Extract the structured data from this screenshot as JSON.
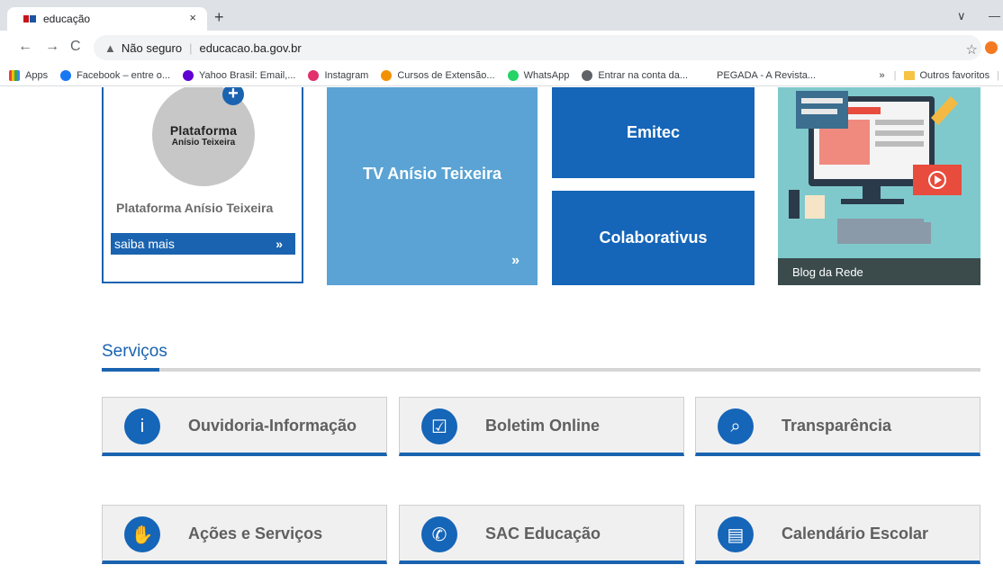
{
  "browser": {
    "tab_title": "educação",
    "tab_close": "×",
    "new_tab": "+",
    "minimize": "—",
    "chevron": "∨",
    "security": "Não seguro",
    "url": "educacao.ba.gov.br",
    "bookmarks": [
      {
        "label": "Apps",
        "color": "#4285f4"
      },
      {
        "label": "Facebook – entre o...",
        "color": "#1877f2"
      },
      {
        "label": "Yahoo Brasil: Email,...",
        "color": "#6001d2"
      },
      {
        "label": "Instagram",
        "color": "#e1306c"
      },
      {
        "label": "Cursos de Extensão...",
        "color": "#f29100"
      },
      {
        "label": "WhatsApp",
        "color": "#25d366"
      },
      {
        "label": "Entrar na conta da...",
        "color": "#5f6368"
      },
      {
        "label": "PEGADA - A Revista...",
        "color": "#ffffff"
      }
    ],
    "bookmarks_more": "»",
    "other_favorites": "Outros favoritos"
  },
  "tiles": {
    "plataforma": {
      "logo_line1": "Plataforma",
      "logo_line2": "Anísio Teixeira",
      "title": "Plataforma Anísio Teixeira",
      "button": "saiba mais",
      "arrow": "»"
    },
    "tv": {
      "title": "TV Anísio Teixeira",
      "arrow": "»"
    },
    "emitec": "Emitec",
    "colaborativus": "Colaborativus",
    "blog": "Blog da Rede"
  },
  "servicos": {
    "title": "Serviços",
    "items": [
      {
        "label": "Ouvidoria-Informação",
        "icon": "info-icon"
      },
      {
        "label": "Boletim Online",
        "icon": "checkbox-icon"
      },
      {
        "label": "Transparência",
        "icon": "magnifier-icon"
      },
      {
        "label": "Ações e Serviços",
        "icon": "hand-icon"
      },
      {
        "label": "SAC Educação",
        "icon": "phone-icon"
      },
      {
        "label": "Calendário Escolar",
        "icon": "calendar-icon"
      }
    ]
  },
  "colors": {
    "primary": "#1565b8",
    "light_blue": "#5aa3d4",
    "chrome": "#dee1e6"
  }
}
